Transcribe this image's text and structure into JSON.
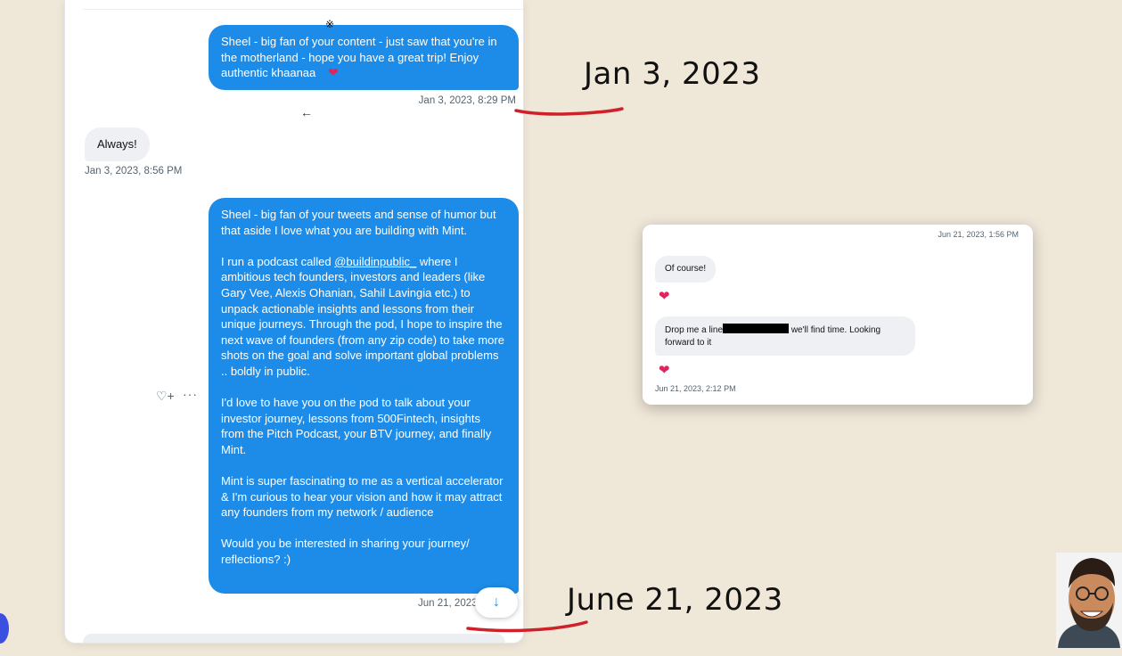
{
  "thread": {
    "messages": [
      {
        "direction": "outgoing",
        "paragraphs": [
          "Sheel - big fan of your content - just saw that you're in the motherland - hope you have a great trip! Enjoy authentic khaanaa"
        ],
        "emoji": "heart",
        "timestamp": "Jan 3, 2023, 8:29 PM"
      },
      {
        "direction": "incoming",
        "paragraphs": [
          "Always!"
        ],
        "timestamp": "Jan 3, 2023, 8:56 PM"
      },
      {
        "direction": "outgoing",
        "paragraphs": [
          "Sheel - big fan of your tweets and sense of humor but that aside I love what you are building with Mint.",
          "I run a podcast called",
          "where I ambitious tech founders, investors and leaders (like Gary Vee, Alexis Ohanian, Sahil Lavingia etc.) to unpack actionable insights and lessons from their unique journeys. Through the pod, I hope to inspire the next wave of founders (from any zip code) to take more shots on the goal and solve important global problems .. boldly in public.",
          "I'd love to have you on the pod to talk about your investor journey, lessons from 500Fintech, insights from the Pitch Podcast, your BTV journey, and finally Mint.",
          "Mint is super fascinating to me as a vertical accelerator & I'm curious to hear your vision and how it may attract any founders from my network / audience",
          "Would you be interested in sharing your journey/ reflections? :)"
        ],
        "mention": "@buildinpublic_",
        "timestamp": "Jun 21, 2023"
      }
    ]
  },
  "icons": {
    "bluetooth": "bluetooth-icon",
    "back": "back-arrow-icon",
    "react": "add-reaction-icon",
    "more": "more-icon",
    "scroll_down": "arrow-down-icon",
    "heart": "heart-icon"
  },
  "annotations": {
    "date_1": "Jan 3, 2023",
    "date_2": "June 21, 2023",
    "underline_color": "#d0202a"
  },
  "card": {
    "top_timestamp": "Jun 21, 2023, 1:56 PM",
    "msg1": "Of course!",
    "msg2_before": "Drop me a line",
    "msg2_after": "we'll find time. Looking forward to it",
    "bottom_timestamp": "Jun 21, 2023, 2:12 PM"
  },
  "colors": {
    "background": "#efe7d8",
    "bubble_outgoing": "#1d8ce8",
    "bubble_incoming": "#eef0f3",
    "heart": "#e0245e"
  }
}
